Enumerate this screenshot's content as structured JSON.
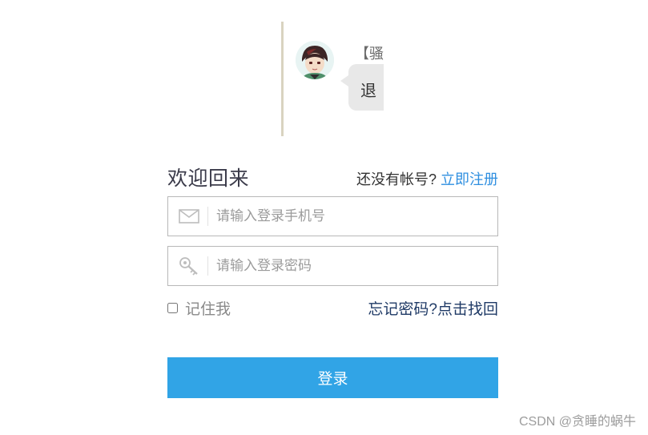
{
  "chat_preview": {
    "name": "【骚",
    "message": "退"
  },
  "login": {
    "title": "欢迎回来",
    "no_account_text": "还没有帐号?",
    "register_link": "立即注册",
    "phone": {
      "placeholder": "请输入登录手机号",
      "icon": "envelope-icon"
    },
    "password": {
      "placeholder": "请输入登录密码",
      "icon": "key-icon"
    },
    "remember_label": "记住我",
    "forgot_link": "忘记密码?点击找回",
    "submit_label": "登录"
  },
  "watermark": "CSDN @贪睡的蜗牛",
  "colors": {
    "accent": "#31a4e6",
    "link": "#2f8fe0",
    "forgot_link": "#1f3a66",
    "border": "#b8b8b8"
  }
}
